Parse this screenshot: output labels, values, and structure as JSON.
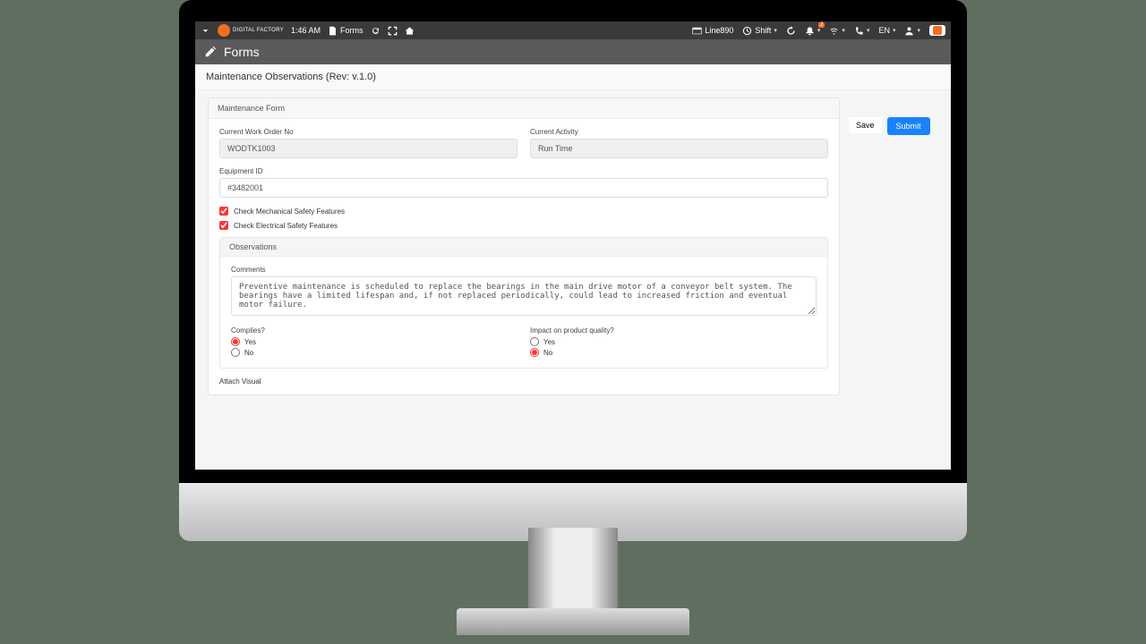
{
  "topbar": {
    "brand_text": "DIGITAL FACTORY",
    "time": "1:46 AM",
    "tab_label": "Forms",
    "line_label": "Line890",
    "shift_label": "Shift",
    "lang": "EN",
    "bell_badge": "2"
  },
  "header": {
    "title": "Forms"
  },
  "page_title": "Maintenance Observations (Rev: v.1.0)",
  "panel_header": "Maintenance Form",
  "buttons": {
    "save": "Save",
    "submit": "Submit"
  },
  "fields": {
    "work_order_label": "Current Work Order No",
    "work_order_value": "WODTK1003",
    "activity_label": "Current Activity",
    "activity_value": "Run Time",
    "equipment_label": "Equipment ID",
    "equipment_value": "#3482001"
  },
  "checkboxes": {
    "mechanical": "Check Mechanical Safety Features",
    "electrical": "Check Electrical Safety Features"
  },
  "observations": {
    "header": "Observations",
    "comments_label": "Comments",
    "comments_value": "Preventive maintenance is scheduled to replace the bearings in the main drive motor of a conveyor belt system. The bearings have a limited lifespan and, if not replaced periodically, could lead to increased friction and eventual motor failure.",
    "complies_label": "Complies?",
    "impact_label": "Impact on product quality?",
    "yes": "Yes",
    "no": "No"
  },
  "attach_label": "Attach Visual"
}
